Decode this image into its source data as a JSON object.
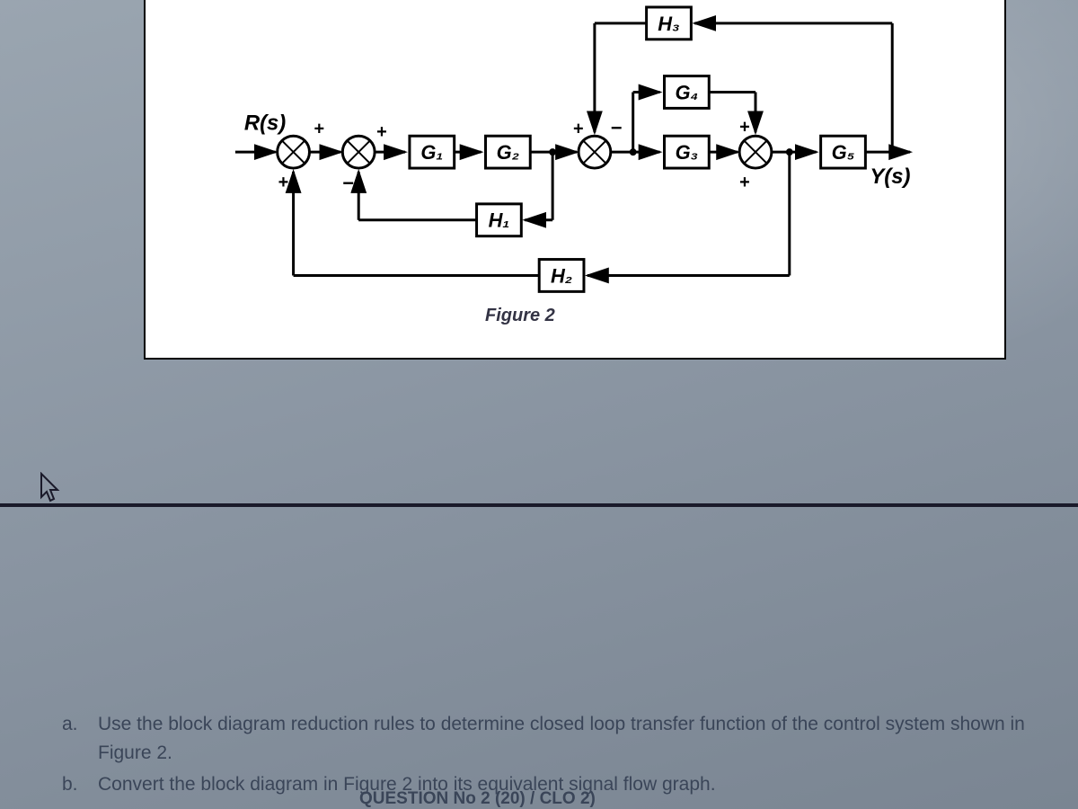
{
  "diagram": {
    "input_label": "R(s)",
    "output_label": "Y(s)",
    "blocks": {
      "G1": "G₁",
      "G2": "G₂",
      "G3": "G₃",
      "G4": "G₄",
      "G5": "G₅",
      "H1": "H₁",
      "H2": "H₂",
      "H3": "H₃"
    },
    "summing_signs": {
      "sj1_top": "+",
      "sj1_bot": "+",
      "sj2_top": "+",
      "sj2_bot": "−",
      "sj3_top": "+",
      "sj3_bot": "−",
      "sj4_top": "+",
      "sj4_bot": "+"
    },
    "caption": "Figure 2"
  },
  "questions": {
    "a": {
      "marker": "a.",
      "text": "Use the block diagram reduction rules to determine closed loop transfer function of the control system shown in Figure 2."
    },
    "b": {
      "marker": "b.",
      "text": "Convert the block diagram in Figure 2 into its equivalent signal flow graph."
    }
  },
  "footer_cutoff": "QUESTION No 2 (20) / CLO 2)"
}
